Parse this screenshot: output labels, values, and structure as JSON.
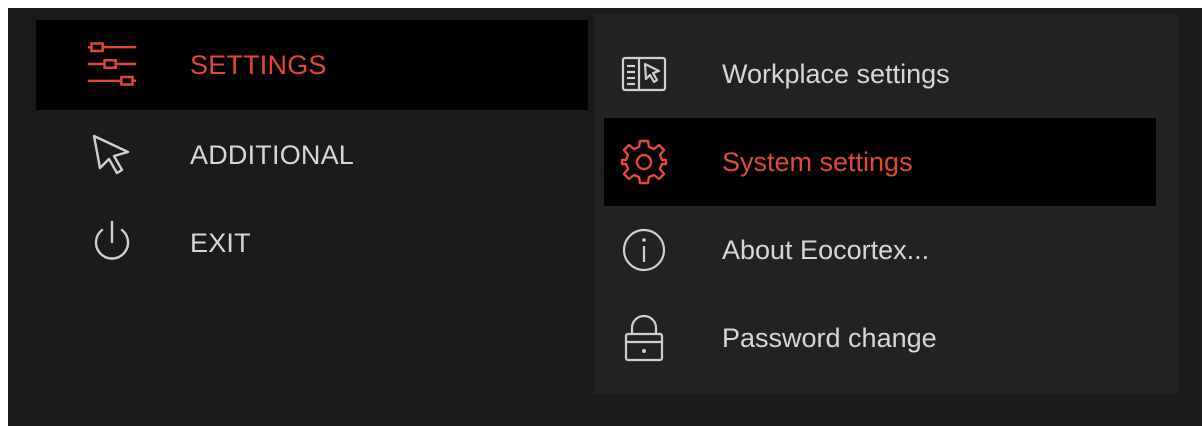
{
  "colors": {
    "accent": "#e04a32",
    "text": "#d7d7d7",
    "icon": "#cfcfcf",
    "panel_bg": "#1b1b1b",
    "active_bg": "#000000"
  },
  "main_menu": {
    "items": [
      {
        "label": "SETTINGS",
        "icon": "sliders-icon",
        "active": true
      },
      {
        "label": "ADDITIONAL",
        "icon": "cursor-icon",
        "active": false
      },
      {
        "label": "EXIT",
        "icon": "power-icon",
        "active": false
      }
    ]
  },
  "settings_submenu": {
    "items": [
      {
        "label": "Workplace settings",
        "icon": "workplace-icon",
        "active": false
      },
      {
        "label": "System settings",
        "icon": "gear-icon",
        "active": true
      },
      {
        "label": "About Eocortex...",
        "icon": "info-icon",
        "active": false
      },
      {
        "label": "Password change",
        "icon": "lock-icon",
        "active": false
      }
    ]
  }
}
